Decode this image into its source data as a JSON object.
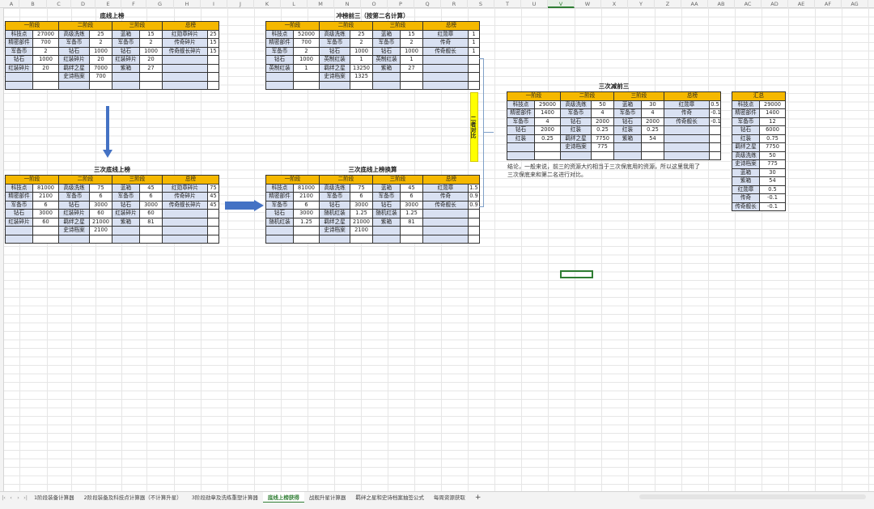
{
  "columns": [
    "A",
    "B",
    "C",
    "D",
    "E",
    "F",
    "G",
    "H",
    "I",
    "J",
    "K",
    "L",
    "M",
    "N",
    "O",
    "P",
    "Q",
    "R",
    "S",
    "T",
    "U",
    "V",
    "W",
    "X",
    "Y",
    "Z",
    "AA",
    "AB",
    "AC",
    "AD",
    "AE",
    "AF",
    "AG"
  ],
  "selected_column": "V",
  "tables": {
    "baseline_top": {
      "title": "底线上榜",
      "headers": [
        "一阶段",
        "二阶段",
        "三阶段",
        "总榜"
      ],
      "rows": [
        [
          "科技点",
          "27000",
          "高级洗练",
          "25",
          "蓝箱",
          "15",
          "红勋章碎片",
          "25"
        ],
        [
          "精密部件",
          "700",
          "军备币",
          "2",
          "军备币",
          "2",
          "传奇碎片",
          "15"
        ],
        [
          "军备币",
          "2",
          "钻石",
          "1000",
          "钻石",
          "1000",
          "传奇舰长碎片",
          "15"
        ],
        [
          "钻石",
          "1000",
          "红装碎片",
          "20",
          "红装碎片",
          "20",
          "",
          ""
        ],
        [
          "红装碎片",
          "20",
          "羁绊之星",
          "7000",
          "紫箱",
          "27",
          "",
          ""
        ],
        [
          "",
          "",
          "史诗档案",
          "700",
          "",
          "",
          "",
          ""
        ],
        [
          "",
          "",
          "",
          "",
          "",
          "",
          "",
          ""
        ]
      ]
    },
    "rush_top3": {
      "title": "冲榜前三（按第二名计算）",
      "headers": [
        "一阶段",
        "二阶段",
        "三阶段",
        "总榜"
      ],
      "rows": [
        [
          "科技点",
          "52000",
          "高级洗练",
          "25",
          "蓝箱",
          "15",
          "红勋章",
          "1"
        ],
        [
          "精密部件",
          "700",
          "军备币",
          "2",
          "军备币",
          "2",
          "传奇",
          "1"
        ],
        [
          "军备币",
          "2",
          "钻石",
          "1000",
          "钻石",
          "1000",
          "传奇舰长",
          "1"
        ],
        [
          "钻石",
          "1000",
          "英制红装",
          "1",
          "英制红装",
          "1",
          "",
          ""
        ],
        [
          "英制红装",
          "1",
          "羁绊之星",
          "13250",
          "紫箱",
          "27",
          "",
          ""
        ],
        [
          "",
          "",
          "史诗档案",
          "1325",
          "",
          "",
          "",
          ""
        ],
        [
          "",
          "",
          "",
          "",
          "",
          "",
          "",
          ""
        ]
      ]
    },
    "triple_baseline": {
      "title": "三次底线上榜",
      "headers": [
        "一阶段",
        "二阶段",
        "三阶段",
        "总榜"
      ],
      "rows": [
        [
          "科技点",
          "81000",
          "高级洗练",
          "75",
          "蓝箱",
          "45",
          "红勋章碎片",
          "75"
        ],
        [
          "精密部件",
          "2100",
          "军备币",
          "6",
          "军备币",
          "6",
          "传奇碎片",
          "45"
        ],
        [
          "军备币",
          "6",
          "钻石",
          "3000",
          "钻石",
          "3000",
          "传奇舰长碎片",
          "45"
        ],
        [
          "钻石",
          "3000",
          "红装碎片",
          "60",
          "红装碎片",
          "60",
          "",
          ""
        ],
        [
          "红装碎片",
          "60",
          "羁绊之星",
          "21000",
          "紫箱",
          "81",
          "",
          ""
        ],
        [
          "",
          "",
          "史诗档案",
          "2100",
          "",
          "",
          "",
          ""
        ],
        [
          "",
          "",
          "",
          "",
          "",
          "",
          "",
          ""
        ]
      ]
    },
    "triple_converted": {
      "title": "三次底线上榜换算",
      "headers": [
        "一阶段",
        "二阶段",
        "三阶段",
        "总榜"
      ],
      "rows": [
        [
          "科技点",
          "81000",
          "高级洗练",
          "75",
          "蓝箱",
          "45",
          "红勋章",
          "1.5"
        ],
        [
          "精密部件",
          "2100",
          "军备币",
          "6",
          "军备币",
          "6",
          "传奇",
          "0.9"
        ],
        [
          "军备币",
          "6",
          "钻石",
          "3000",
          "钻石",
          "3000",
          "传奇舰长",
          "0.9"
        ],
        [
          "钻石",
          "3000",
          "随机红装",
          "1.25",
          "随机红装",
          "1.25",
          "",
          ""
        ],
        [
          "随机红装",
          "1.25",
          "羁绊之星",
          "21000",
          "紫箱",
          "81",
          "",
          ""
        ],
        [
          "",
          "",
          "史诗档案",
          "2100",
          "",
          "",
          "",
          ""
        ],
        [
          "",
          "",
          "",
          "",
          "",
          "",
          "",
          ""
        ]
      ]
    },
    "triple_minus_top3": {
      "title": "三次减前三",
      "headers": [
        "一阶段",
        "二阶段",
        "三阶段",
        "总榜"
      ],
      "rows": [
        [
          "科技点",
          "29000",
          "高级洗练",
          "50",
          "蓝箱",
          "30",
          "红勋章",
          "0.5"
        ],
        [
          "精密部件",
          "1400",
          "军备币",
          "4",
          "军备币",
          "4",
          "传奇",
          "-0.1"
        ],
        [
          "军备币",
          "4",
          "钻石",
          "2000",
          "钻石",
          "2000",
          "传奇舰长",
          "-0.1"
        ],
        [
          "钻石",
          "2000",
          "红装",
          "0.25",
          "红装",
          "0.25",
          "",
          ""
        ],
        [
          "红装",
          "0.25",
          "羁绊之星",
          "7750",
          "紫箱",
          "54",
          "",
          ""
        ],
        [
          "",
          "",
          "史诗档案",
          "775",
          "",
          "",
          "",
          ""
        ],
        [
          "",
          "",
          "",
          "",
          "",
          "",
          "",
          ""
        ]
      ]
    },
    "summary": {
      "title": "汇总",
      "rows": [
        [
          "科技点",
          "29000"
        ],
        [
          "精密部件",
          "1400"
        ],
        [
          "军备币",
          "12"
        ],
        [
          "钻石",
          "6000"
        ],
        [
          "红装",
          "0.75"
        ],
        [
          "羁绊之星",
          "7750"
        ],
        [
          "高级洗练",
          "50"
        ],
        [
          "史诗档案",
          "775"
        ],
        [
          "蓝箱",
          "30"
        ],
        [
          "紫箱",
          "54"
        ],
        [
          "红勋章",
          "0.5"
        ],
        [
          "传奇",
          "-0.1"
        ],
        [
          "传奇舰长",
          "-0.1"
        ]
      ]
    }
  },
  "compare_label": "二者对比",
  "conclusion": "结论，一般来说，前三的资源大约相当于三次保底用的资源，所以这里我用了三次保底来和第二名进行对比。",
  "tabs": [
    {
      "label": "1阶段装备计算器",
      "active": false
    },
    {
      "label": "2阶段装备及科技点计算器（不计算升星）",
      "active": false
    },
    {
      "label": "3阶段勋章及洗练重塑计算器",
      "active": false
    },
    {
      "label": "底线上榜获得",
      "active": true
    },
    {
      "label": "战舰升星计算器",
      "active": false
    },
    {
      "label": "羁绊之星和史诗档案抽签公式",
      "active": false
    },
    {
      "label": "每周资源获取",
      "active": false
    }
  ],
  "add_tab": "+",
  "colors": {
    "header": "#f5b800",
    "label_fill": "#d9e1f2",
    "arrow": "#4472c4",
    "highlight": "#ffff00",
    "accent": "#2e7d32"
  }
}
